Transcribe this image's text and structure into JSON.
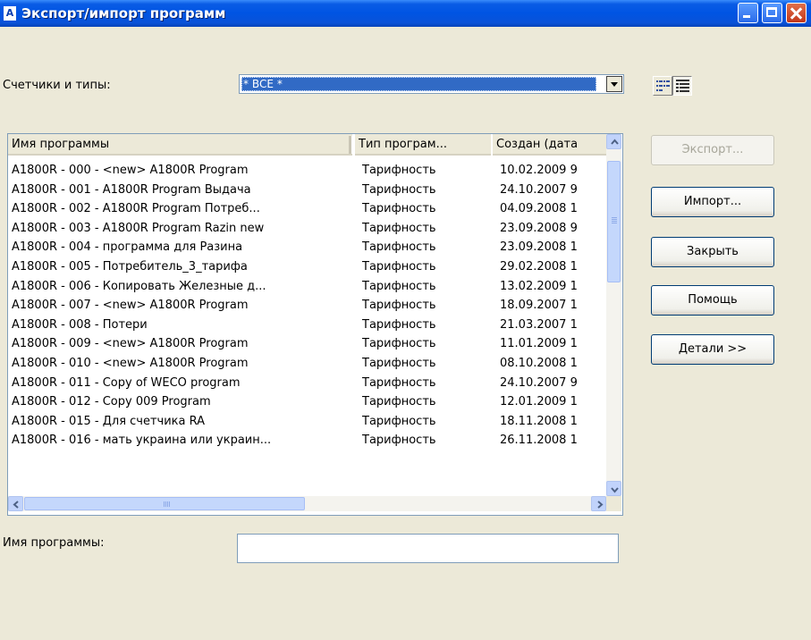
{
  "window": {
    "title": "Экспорт/импорт программ",
    "icon_letter": "A",
    "controls": [
      "minimize-icon",
      "maximize-icon",
      "close-icon"
    ]
  },
  "filter": {
    "label": "Счетчики и типы:",
    "selected": "* ВСЕ *"
  },
  "view_toggle": [
    "list-view-icon",
    "details-view-icon"
  ],
  "list": {
    "columns": [
      "Имя программы",
      "Тип програм...",
      "Создан (дата"
    ],
    "rows": [
      {
        "name": "A1800R - 000 - <new> A1800R Program",
        "type": "Тарифность",
        "created": "10.02.2009 9"
      },
      {
        "name": "A1800R - 001 -  A1800R Program Выдача",
        "type": "Тарифность",
        "created": "24.10.2007 9"
      },
      {
        "name": "A1800R - 002 -  A1800R Program Потреб...",
        "type": "Тарифность",
        "created": "04.09.2008 1"
      },
      {
        "name": "A1800R - 003 - A1800R Program Razin new",
        "type": "Тарифность",
        "created": "23.09.2008 9"
      },
      {
        "name": "A1800R - 004 - программа для Разина",
        "type": "Тарифность",
        "created": "23.09.2008 1"
      },
      {
        "name": "A1800R - 005 - Потребитель_3_тарифа",
        "type": "Тарифность",
        "created": "29.02.2008 1"
      },
      {
        "name": "A1800R - 006 - Копировать Железные д...",
        "type": "Тарифность",
        "created": "13.02.2009 1"
      },
      {
        "name": "A1800R - 007 - <new> A1800R Program",
        "type": "Тарифность",
        "created": "18.09.2007 1"
      },
      {
        "name": "A1800R - 008 - Потери",
        "type": "Тарифность",
        "created": "21.03.2007 1"
      },
      {
        "name": "A1800R - 009 - <new> A1800R Program",
        "type": "Тарифность",
        "created": "11.01.2009 1"
      },
      {
        "name": "A1800R - 010 - <new> A1800R Program",
        "type": "Тарифность",
        "created": "08.10.2008 1"
      },
      {
        "name": "A1800R - 011 - Copy of WECO program",
        "type": "Тарифность",
        "created": "24.10.2007 9"
      },
      {
        "name": "A1800R - 012 - Copy 009 Program",
        "type": "Тарифность",
        "created": "12.01.2009 1"
      },
      {
        "name": "A1800R - 015 - Для счетчика RA",
        "type": "Тарифность",
        "created": "18.11.2008 1"
      },
      {
        "name": "A1800R - 016 - мать украина или украин...",
        "type": "Тарифность",
        "created": "26.11.2008 1"
      }
    ]
  },
  "buttons": {
    "export": "Экспорт...",
    "import": "Импорт...",
    "close": "Закрыть",
    "help": "Помощь",
    "details": "Детали >>"
  },
  "program_name": {
    "label": "Имя программы:",
    "value": ""
  }
}
